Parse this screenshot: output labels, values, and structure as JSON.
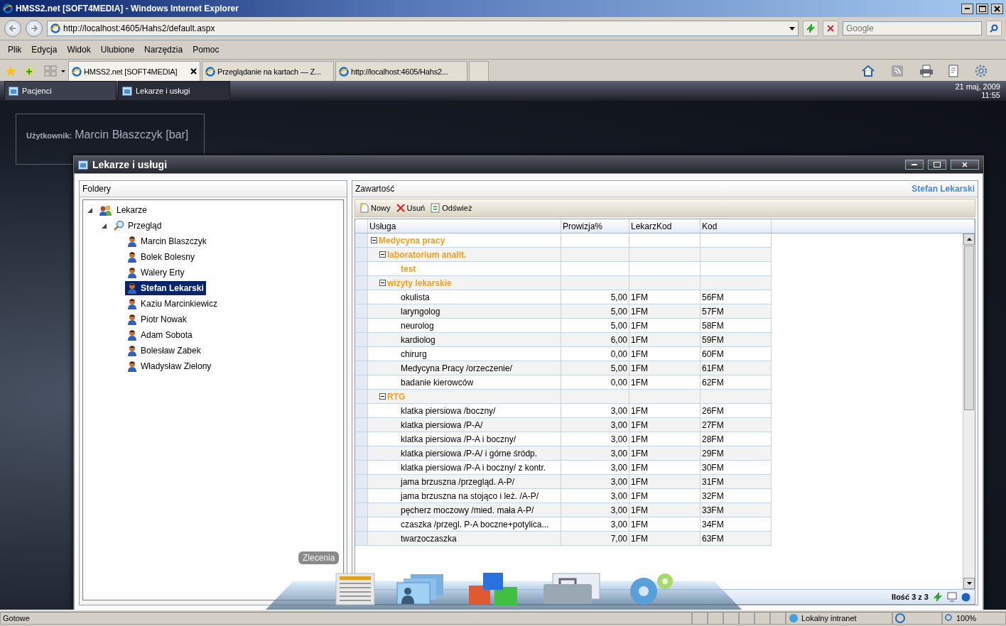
{
  "browser": {
    "title": "HMSS2.net [SOFT4MEDIA] - Windows Internet Explorer",
    "address": "http://localhost:4605/Hahs2/default.aspx",
    "search_placeholder": "Google",
    "menu": [
      "Plik",
      "Edycja",
      "Widok",
      "Ulubione",
      "Narzędzia",
      "Pomoc"
    ],
    "tabs": [
      {
        "label": "HMSS2.net [SOFT4MEDIA]",
        "selected": true
      },
      {
        "label": "Przeglądanie na kartach — Z...",
        "selected": false
      },
      {
        "label": "http://localhost:4605/Hahs2...",
        "selected": false
      }
    ],
    "status": "Gotowe",
    "zone": "Lokalny intranet",
    "zoom": "100%"
  },
  "app": {
    "taskbar": [
      {
        "label": "Pacjenci",
        "selected": false
      },
      {
        "label": "Lekarze i usługi",
        "selected": true
      }
    ],
    "date": "21 maj, 2009",
    "time": "11:55",
    "user_label": "Użytkownik:",
    "user_name": "Marcin Błaszczyk [bar]"
  },
  "window": {
    "title": "Lekarze i usługi",
    "folders": {
      "title": "Foldery",
      "tree": [
        {
          "label": "Lekarze",
          "kind": "group",
          "expanded": true,
          "selected": false,
          "children": [
            {
              "label": "Przegląd",
              "kind": "search",
              "expanded": true,
              "selected": false,
              "children": [
                {
                  "label": "Marcin Blaszczyk",
                  "kind": "doctor",
                  "selected": false
                },
                {
                  "label": "Bolek Bolesny",
                  "kind": "doctor",
                  "selected": false
                },
                {
                  "label": "Walery Erty",
                  "kind": "doctor",
                  "selected": false
                },
                {
                  "label": "Stefan Lekarski",
                  "kind": "doctor",
                  "selected": true
                },
                {
                  "label": "Kaziu Marcinkiewicz",
                  "kind": "doctor",
                  "selected": false
                },
                {
                  "label": "Piotr Nowak",
                  "kind": "doctor",
                  "selected": false
                },
                {
                  "label": "Adam Sobota",
                  "kind": "doctor",
                  "selected": false
                },
                {
                  "label": "Bolesław Zabek",
                  "kind": "doctor",
                  "selected": false
                },
                {
                  "label": "Władysław Zielony",
                  "kind": "doctor",
                  "selected": false
                }
              ]
            }
          ]
        }
      ]
    },
    "content": {
      "title": "Zawartość",
      "doctor": "Stefan Lekarski",
      "toolbar": [
        {
          "label": "Nowy",
          "kind": "new"
        },
        {
          "label": "Usuń",
          "kind": "delete"
        },
        {
          "label": "Odśwież",
          "kind": "refresh"
        }
      ],
      "columns": [
        "Usługa",
        "Prowizja%",
        "LekarzKod",
        "Kod"
      ],
      "rows": [
        {
          "kind": "group",
          "label": "Medycyna pracy",
          "expanded": true,
          "children": [
            {
              "kind": "group",
              "label": "laboratorium analit.",
              "expanded": true,
              "children": [
                {
                  "kind": "group",
                  "label": "test"
                }
              ]
            },
            {
              "kind": "group",
              "label": "wizyty lekarskie",
              "expanded": true,
              "children": [
                {
                  "kind": "service",
                  "label": "okulista",
                  "provision": "5,00",
                  "doctor_code": "1FM",
                  "code": "56FM"
                },
                {
                  "kind": "service",
                  "label": "laryngolog",
                  "provision": "5,00",
                  "doctor_code": "1FM",
                  "code": "57FM"
                },
                {
                  "kind": "service",
                  "label": "neurolog",
                  "provision": "5,00",
                  "doctor_code": "1FM",
                  "code": "58FM"
                },
                {
                  "kind": "service",
                  "label": "kardiolog",
                  "provision": "6,00",
                  "doctor_code": "1FM",
                  "code": "59FM"
                },
                {
                  "kind": "service",
                  "label": "chirurg",
                  "provision": "0,00",
                  "doctor_code": "1FM",
                  "code": "60FM"
                },
                {
                  "kind": "service",
                  "label": "Medycyna Pracy /orzeczenie/",
                  "provision": "5,00",
                  "doctor_code": "1FM",
                  "code": "61FM"
                },
                {
                  "kind": "service",
                  "label": "badanie kierowców",
                  "provision": "0,00",
                  "doctor_code": "1FM",
                  "code": "62FM"
                }
              ]
            },
            {
              "kind": "group",
              "label": "RTG",
              "expanded": true,
              "children": [
                {
                  "kind": "service",
                  "label": "klatka piersiowa /boczny/",
                  "provision": "3,00",
                  "doctor_code": "1FM",
                  "code": "26FM"
                },
                {
                  "kind": "service",
                  "label": "klatka piersiowa /P-A/",
                  "provision": "3,00",
                  "doctor_code": "1FM",
                  "code": "27FM"
                },
                {
                  "kind": "service",
                  "label": "klatka piersiowa /P-A i boczny/",
                  "provision": "3,00",
                  "doctor_code": "1FM",
                  "code": "28FM"
                },
                {
                  "kind": "service",
                  "label": "klatka piersiowa /P-A/ i górne śródp.",
                  "provision": "3,00",
                  "doctor_code": "1FM",
                  "code": "29FM"
                },
                {
                  "kind": "service",
                  "label": "klatka piersiowa /P-A i boczny/ z kontr.",
                  "provision": "3,00",
                  "doctor_code": "1FM",
                  "code": "30FM"
                },
                {
                  "kind": "service",
                  "label": "jama brzuszna /przegląd. A-P/",
                  "provision": "3,00",
                  "doctor_code": "1FM",
                  "code": "31FM"
                },
                {
                  "kind": "service",
                  "label": "jama brzuszna na stojąco i leż. /A-P/",
                  "provision": "3,00",
                  "doctor_code": "1FM",
                  "code": "32FM"
                },
                {
                  "kind": "service",
                  "label": "pęcherz moczowy /mied. mała A-P/",
                  "provision": "3,00",
                  "doctor_code": "1FM",
                  "code": "33FM"
                },
                {
                  "kind": "service",
                  "label": "czaszka /przegl. P-A boczne+potylica...",
                  "provision": "3,00",
                  "doctor_code": "1FM",
                  "code": "34FM"
                },
                {
                  "kind": "service",
                  "label": "twarzoczaszka",
                  "provision": "7,00",
                  "doctor_code": "1FM",
                  "code": "63FM"
                }
              ]
            }
          ]
        }
      ],
      "count": "Ilość 3 z 3"
    }
  },
  "dock": {
    "tooltip": "Zlecenia",
    "items": [
      {
        "kind": "document"
      },
      {
        "kind": "people"
      },
      {
        "kind": "cubes"
      },
      {
        "kind": "toolbox"
      },
      {
        "kind": "gears"
      }
    ]
  }
}
